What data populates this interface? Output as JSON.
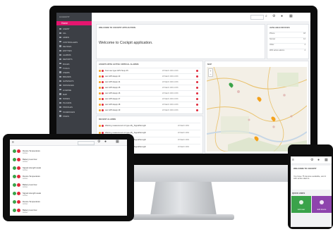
{
  "colors": {
    "accent": "#e6156f",
    "green": "#3aa34a",
    "red": "#e0283a",
    "orange": "#f4a11b",
    "purple": "#8e44ad",
    "sidebar": "#3c3f45"
  },
  "desktop": {
    "brand": "COCKPIT",
    "home_label": "Home",
    "nav": [
      "AGENT",
      "ALL",
      "ADMIN",
      "CONTROLLERS",
      "DEVICES",
      "ENTITIES",
      "ALARMS",
      "REPORTS",
      "RULES",
      "TOOLS",
      "USERS",
      "BRANDS",
      "GATEWAYS",
      "INSTANCES",
      "LICENSE",
      "MAP",
      "NODES",
      "PLUGINS",
      "PROFILES",
      "SCHEDULES",
      "TASKS"
    ],
    "welcome_header": "WELCOME TO COCKPIT APPLICATION",
    "welcome_text": "Welcome to Cockpit application.",
    "avail_header": "AVAILABLE DEVICES",
    "avail_rows": [
      {
        "k": "Phone",
        "v": "18"
      },
      {
        "k": "Sensor",
        "v": "14"
      },
      {
        "k": "Other",
        "v": "4"
      },
      {
        "k": "With active alarms",
        "v": "4"
      }
    ],
    "alarms_header": "ASSETS WITH ACTIVE CRITICAL ALARMS",
    "alarms": [
      {
        "name": "Test new type GPS Temp 45",
        "date": "20 March 2019 10:46"
      },
      {
        "name": "test GPS Equip 43",
        "date": "20 March 2019 10:36"
      },
      {
        "name": "test GPS Equip 44",
        "date": "20 March 2019 10:36"
      },
      {
        "name": "test GPS Equip 45",
        "date": "20 March 2019 10:36"
      },
      {
        "name": "test GPS Equip 46",
        "date": "20 March 2019 10:36"
      },
      {
        "name": "test GPS Equip 47",
        "date": "20 March 2019 10:36"
      },
      {
        "name": "test GPS Equip 48",
        "date": "20 March 2019 10:36"
      },
      {
        "name": "test GPS Equip 49",
        "date": "20 March 2019 10:36"
      }
    ],
    "recent_header": "RECENT ALARMS",
    "recent": [
      {
        "name": "Warning measurement of type c8y_SignalStrength",
        "date": "20 March 2019"
      },
      {
        "name": "Warning measurement of type c8y_SignalStrength",
        "date": "20 March 2019"
      },
      {
        "name": "Warning measurement of type c8y_SignalStrength",
        "date": "20 March 2019"
      },
      {
        "name": "Warning measurement of type c8y_SignalStrength",
        "date": "20 March 2019"
      }
    ],
    "map_header": "MAP"
  },
  "tablet": {
    "rows": [
      {
        "title": "Device Temperature",
        "sub": "Active"
      },
      {
        "title": "Battery level low",
        "sub": "Active"
      },
      {
        "title": "Signal strength weak",
        "sub": "Active"
      },
      {
        "title": "Device Temperature",
        "sub": "Active"
      },
      {
        "title": "Battery level low",
        "sub": "Active"
      },
      {
        "title": "Signal strength weak",
        "sub": "Active"
      },
      {
        "title": "Device Temperature",
        "sub": "Active"
      },
      {
        "title": "Battery level low",
        "sub": "Active"
      }
    ]
  },
  "phone": {
    "title": "WELCOME TO COCKPIT",
    "text": "You have 75 devices available, and 4 with active alarms.",
    "quick_header": "QUICK LINKS",
    "tiles": [
      {
        "label": "Add user",
        "color": "#3aa34a"
      },
      {
        "label": "Edit device",
        "color": "#8e44ad"
      }
    ]
  }
}
